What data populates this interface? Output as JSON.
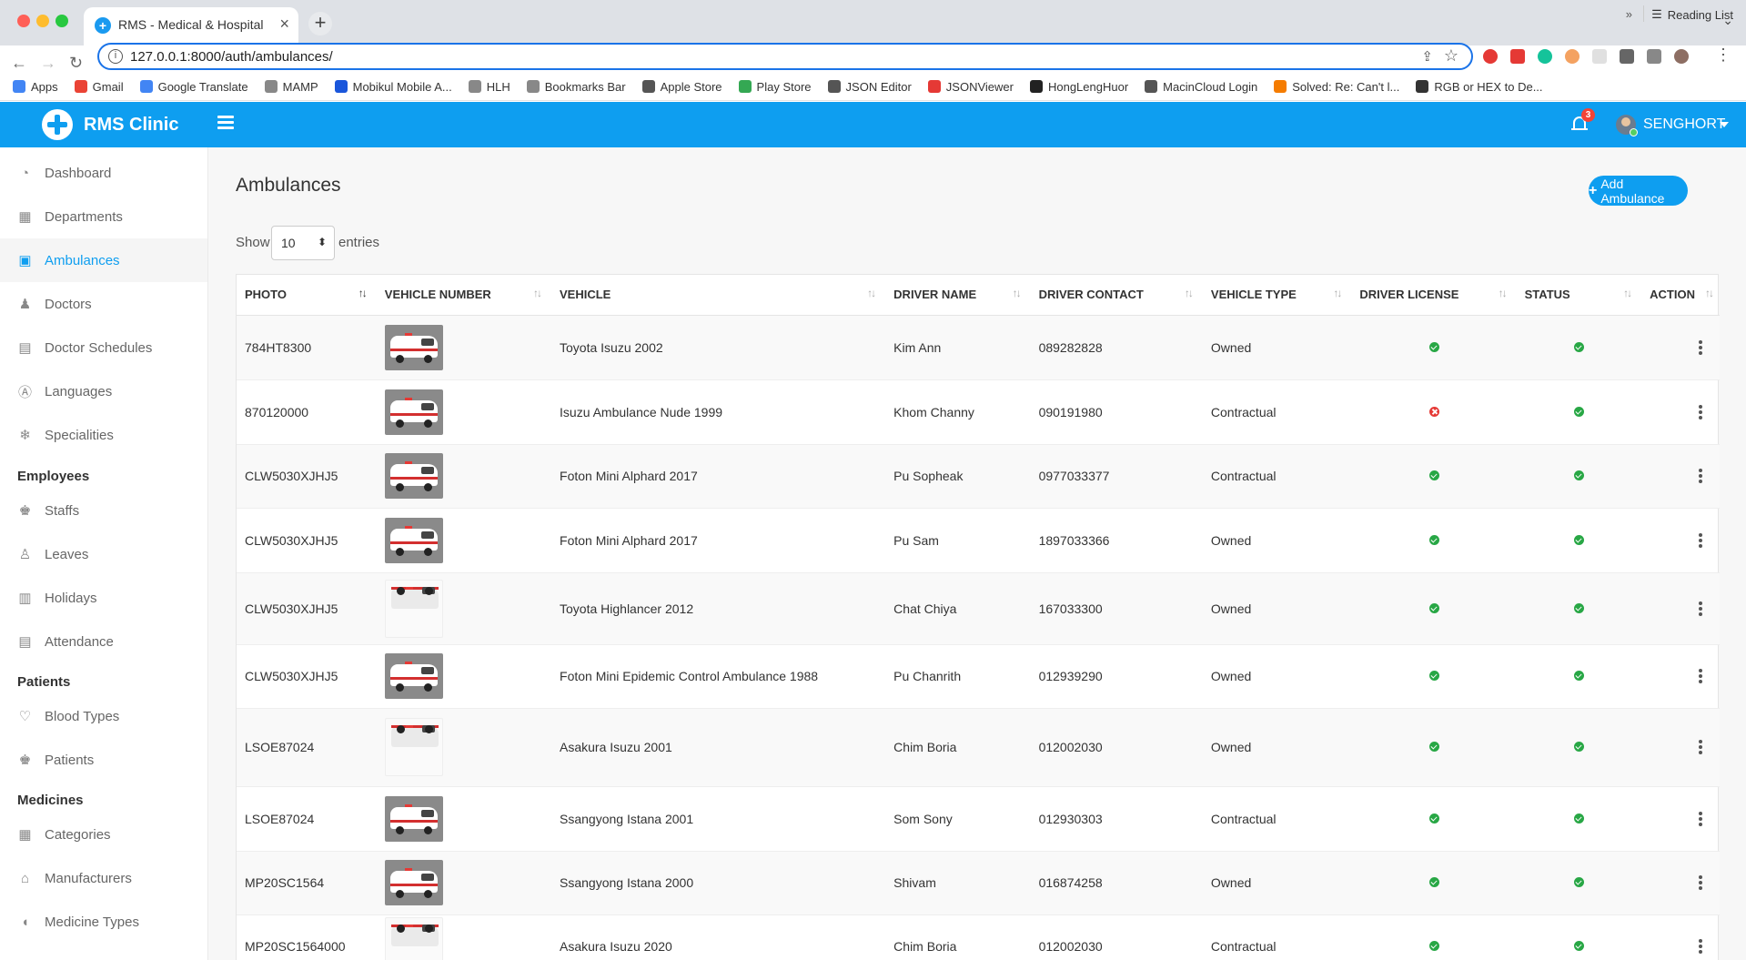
{
  "browser": {
    "tab_title": "RMS - Medical & Hospital",
    "url": "127.0.0.1:8000/auth/ambulances/",
    "bookmarks": [
      "Apps",
      "Gmail",
      "Google Translate",
      "MAMP",
      "Mobikul Mobile A...",
      "HLH",
      "Bookmarks Bar",
      "Apple Store",
      "Play Store",
      "JSON Editor",
      "JSONViewer",
      "HongLengHuor",
      "MacinCloud Login",
      "Solved: Re: Can't l...",
      "RGB or HEX to De..."
    ],
    "bookmark_colors": [
      "#4285f4",
      "#ea4335",
      "#4285f4",
      "#888888",
      "#1a56db",
      "#888888",
      "#888888",
      "#555555",
      "#34a853",
      "#555555",
      "#e53935",
      "#222222",
      "#555555",
      "#f57c00",
      "#333333"
    ],
    "more_bookmarks": "»",
    "reading_list": "Reading List"
  },
  "header": {
    "brand": "RMS Clinic",
    "notification_count": "3",
    "user_name": "SENGHORT"
  },
  "sidebar": {
    "items": [
      {
        "label": "Dashboard",
        "icon": "dashboard-icon"
      },
      {
        "label": "Departments",
        "icon": "hospital-icon"
      },
      {
        "label": "Ambulances",
        "icon": "bus-icon",
        "active": true
      },
      {
        "label": "Doctors",
        "icon": "doctor-icon"
      },
      {
        "label": "Doctor Schedules",
        "icon": "calendar-check-icon"
      },
      {
        "label": "Languages",
        "icon": "language-icon"
      },
      {
        "label": "Specialities",
        "icon": "snowflake-icon"
      }
    ],
    "section_employees": "Employees",
    "employees_items": [
      {
        "label": "Staffs",
        "icon": "users-icon"
      },
      {
        "label": "Leaves",
        "icon": "walking-icon"
      },
      {
        "label": "Holidays",
        "icon": "gift-icon"
      },
      {
        "label": "Attendance",
        "icon": "calendar-icon"
      }
    ],
    "section_patients": "Patients",
    "patients_items": [
      {
        "label": "Blood Types",
        "icon": "heartbeat-icon"
      },
      {
        "label": "Patients",
        "icon": "users-icon"
      }
    ],
    "section_medicines": "Medicines",
    "medicines_items": [
      {
        "label": "Categories",
        "icon": "grid-icon"
      },
      {
        "label": "Manufacturers",
        "icon": "bank-icon"
      },
      {
        "label": "Medicine Types",
        "icon": "pills-icon"
      }
    ]
  },
  "main": {
    "title": "Ambulances",
    "add_button": "Add Ambulance",
    "show_label": "Show",
    "entries_value": "10",
    "entries_label": "entries",
    "columns": [
      "PHOTO",
      "VEHICLE NUMBER",
      "VEHICLE",
      "DRIVER NAME",
      "DRIVER CONTACT",
      "VEHICLE TYPE",
      "DRIVER LICENSE",
      "STATUS",
      "ACTION"
    ],
    "rows": [
      {
        "number": "784HT8300",
        "vehicle": "Toyota Isuzu 2002",
        "driver": "Kim Ann",
        "contact": "089282828",
        "type": "Owned",
        "license": true,
        "status": true,
        "photo": "van-red-stripe"
      },
      {
        "number": "870120000",
        "vehicle": "Isuzu Ambulance Nude 1999",
        "driver": "Khom Channy",
        "contact": "090191980",
        "type": "Contractual",
        "license": false,
        "status": true,
        "photo": "van-red-stripe"
      },
      {
        "number": "CLW5030XJHJ5",
        "vehicle": "Foton Mini Alphard 2017",
        "driver": "Pu Sopheak",
        "contact": "0977033377",
        "type": "Contractual",
        "license": true,
        "status": true,
        "photo": "van-red-stripe"
      },
      {
        "number": "CLW5030XJHJ5",
        "vehicle": "Foton Mini Alphard 2017",
        "driver": "Pu Sam",
        "contact": "1897033366",
        "type": "Owned",
        "license": true,
        "status": true,
        "photo": "van-red-stripe"
      },
      {
        "number": "CLW5030XJHJ5",
        "vehicle": "Toyota Highlancer 2012",
        "driver": "Chat Chiya",
        "contact": "167033300",
        "type": "Owned",
        "license": true,
        "status": true,
        "photo": "van-white"
      },
      {
        "number": "CLW5030XJHJ5",
        "vehicle": "Foton Mini Epidemic Control Ambulance 1988",
        "driver": "Pu Chanrith",
        "contact": "012939290",
        "type": "Owned",
        "license": true,
        "status": true,
        "photo": "van-red-stripe"
      },
      {
        "number": "LSOE87024",
        "vehicle": "Asakura Isuzu 2001",
        "driver": "Chim Boria",
        "contact": "012002030",
        "type": "Owned",
        "license": true,
        "status": true,
        "photo": "van-white"
      },
      {
        "number": "LSOE87024",
        "vehicle": "Ssangyong Istana 2001",
        "driver": "Som Sony",
        "contact": "012930303",
        "type": "Contractual",
        "license": true,
        "status": true,
        "photo": "van-red-stripe"
      },
      {
        "number": "MP20SC1564",
        "vehicle": "Ssangyong Istana 2000",
        "driver": "Shivam",
        "contact": "016874258",
        "type": "Owned",
        "license": true,
        "status": true,
        "photo": "van-red-stripe"
      },
      {
        "number": "MP20SC1564000",
        "vehicle": "Asakura Isuzu 2020",
        "driver": "Chim Boria",
        "contact": "012002030",
        "type": "Contractual",
        "license": true,
        "status": true,
        "photo": "van-white"
      }
    ]
  },
  "colors": {
    "primary": "#0e9ef0",
    "success": "#28a745",
    "danger": "#e53935",
    "badge": "#f44336"
  }
}
